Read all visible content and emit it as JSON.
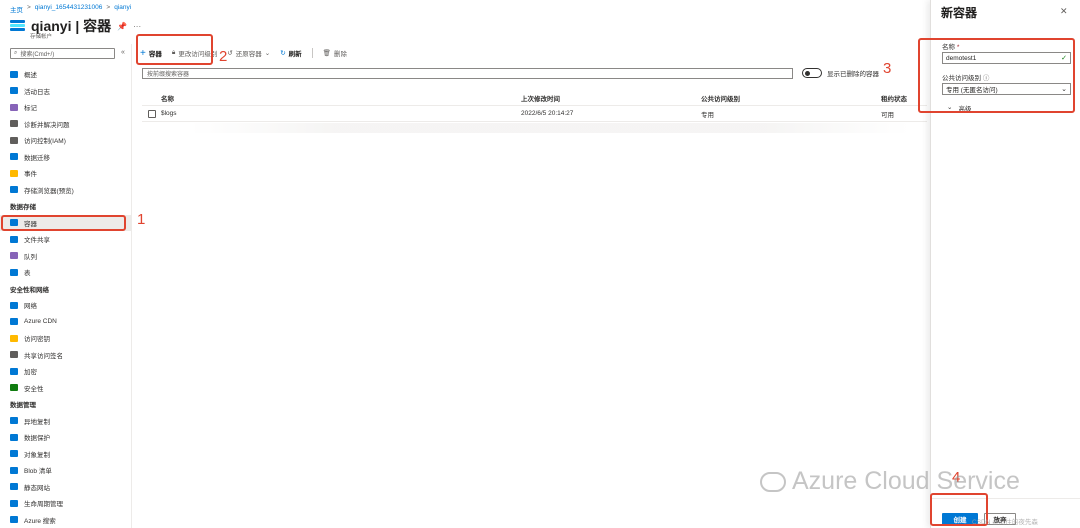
{
  "breadcrumb": [
    "主页",
    "qianyi_1654431231006",
    "qianyi"
  ],
  "header": {
    "title": "qianyi | 容器",
    "subtitle": "存储帐户"
  },
  "sidebar": {
    "search_placeholder": "搜索(Cmd+/)",
    "items": [
      {
        "type": "item",
        "label": "概述",
        "color": "#0078d4"
      },
      {
        "type": "item",
        "label": "活动日志",
        "color": "#0078d4"
      },
      {
        "type": "item",
        "label": "标记",
        "color": "#8764b8"
      },
      {
        "type": "item",
        "label": "诊断并解决问题",
        "color": "#605e5c"
      },
      {
        "type": "item",
        "label": "访问控制(IAM)",
        "color": "#605e5c"
      },
      {
        "type": "item",
        "label": "数据迁移",
        "color": "#0078d4"
      },
      {
        "type": "item",
        "label": "事件",
        "color": "#ffb900"
      },
      {
        "type": "item",
        "label": "存储浏览器(预览)",
        "color": "#0078d4"
      },
      {
        "type": "section",
        "label": "数据存储"
      },
      {
        "type": "item",
        "label": "容器",
        "color": "#0078d4",
        "active": true
      },
      {
        "type": "item",
        "label": "文件共享",
        "color": "#0078d4"
      },
      {
        "type": "item",
        "label": "队列",
        "color": "#8764b8"
      },
      {
        "type": "item",
        "label": "表",
        "color": "#0078d4"
      },
      {
        "type": "section",
        "label": "安全性和网络"
      },
      {
        "type": "item",
        "label": "网络",
        "color": "#0078d4"
      },
      {
        "type": "item",
        "label": "Azure CDN",
        "color": "#0078d4"
      },
      {
        "type": "item",
        "label": "访问密钥",
        "color": "#ffb900"
      },
      {
        "type": "item",
        "label": "共享访问签名",
        "color": "#605e5c"
      },
      {
        "type": "item",
        "label": "加密",
        "color": "#0078d4"
      },
      {
        "type": "item",
        "label": "安全性",
        "color": "#107c10"
      },
      {
        "type": "section",
        "label": "数据管理"
      },
      {
        "type": "item",
        "label": "异地复制",
        "color": "#0078d4"
      },
      {
        "type": "item",
        "label": "数据保护",
        "color": "#0078d4"
      },
      {
        "type": "item",
        "label": "对象复制",
        "color": "#0078d4"
      },
      {
        "type": "item",
        "label": "Blob 清单",
        "color": "#0078d4"
      },
      {
        "type": "item",
        "label": "静态网站",
        "color": "#0078d4"
      },
      {
        "type": "item",
        "label": "生命周期管理",
        "color": "#0078d4"
      },
      {
        "type": "item",
        "label": "Azure 搜索",
        "color": "#0078d4"
      }
    ]
  },
  "toolbar": {
    "add_label": "容器",
    "access_label": "更改访问级别",
    "restore_label": "还原容器",
    "refresh_label": "刷新",
    "delete_label": "删除"
  },
  "filter": {
    "placeholder": "按前缀搜索容器"
  },
  "toggle_label": "显示已删除的容器",
  "table": {
    "headers": [
      "名称",
      "上次修改时间",
      "公共访问级别",
      "租约状态"
    ],
    "rows": [
      {
        "name": "$logs",
        "modified": "2022/6/5 20:14:27",
        "access": "专用",
        "lease": "可用"
      }
    ]
  },
  "panel": {
    "title": "新容器",
    "name_label": "名称",
    "name_required": "*",
    "name_value": "demotest1",
    "access_label": "公共访问级别",
    "access_value": "专用 (无匿名访问)",
    "advanced_label": "高级",
    "create_label": "创建",
    "discard_label": "放弃"
  },
  "annotations": [
    "1",
    "2",
    "3",
    "4"
  ],
  "watermark": {
    "text": "Azure Cloud Service",
    "csdn": "CSDN @向往的夜先森"
  },
  "colors": {
    "accent": "#0078d4",
    "annotation": "#e0442f"
  }
}
